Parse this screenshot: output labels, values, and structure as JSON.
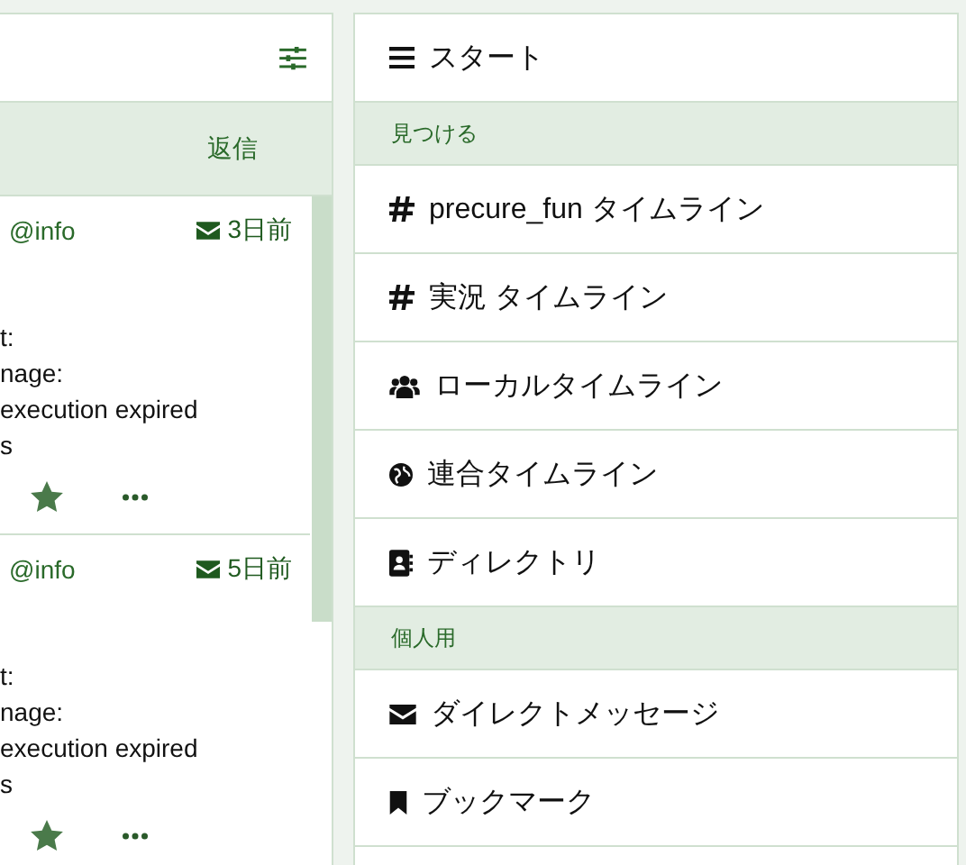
{
  "column": {
    "tabs": [
      {
        "label": "返信",
        "selected": true
      }
    ],
    "statuses": [
      {
        "account": "@info",
        "time": "3日前",
        "lines": [
          "t:",
          "nage:",
          "execution expired",
          "s"
        ],
        "favourited": true
      },
      {
        "account": "@info",
        "time": "5日前",
        "lines": [
          "t:",
          "nage:",
          "execution expired",
          "s"
        ],
        "favourited": true
      }
    ]
  },
  "nav": {
    "items": [
      {
        "kind": "menu",
        "label": "スタート"
      },
      {
        "kind": "header",
        "label": "見つける"
      },
      {
        "kind": "hashtag",
        "label": "precure_fun タイムライン"
      },
      {
        "kind": "hashtag",
        "label": "実況 タイムライン"
      },
      {
        "kind": "users",
        "label": "ローカルタイムライン"
      },
      {
        "kind": "globe",
        "label": "連合タイムライン"
      },
      {
        "kind": "directory",
        "label": "ディレクトリ"
      },
      {
        "kind": "header",
        "label": "個人用"
      },
      {
        "kind": "mail",
        "label": "ダイレクトメッセージ"
      },
      {
        "kind": "bookmark",
        "label": "ブックマーク"
      },
      {
        "kind": "blank"
      }
    ]
  }
}
